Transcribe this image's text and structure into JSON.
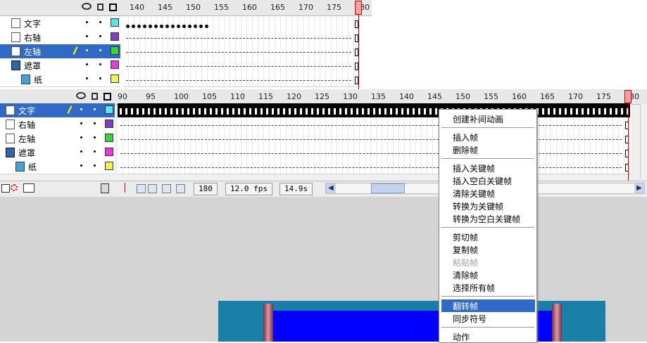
{
  "top_panel": {
    "ruler_ticks": [
      "140",
      "145",
      "150",
      "155",
      "160",
      "165",
      "170",
      "175",
      "180"
    ],
    "layers": [
      {
        "name": "文字",
        "icon": "layer-icon",
        "color": "#5ee3ee"
      },
      {
        "name": "右轴",
        "icon": "layer-icon",
        "color": "#7d3ec0"
      },
      {
        "name": "左轴",
        "icon": "layer-icon",
        "color": "#3ad13a",
        "selected": true
      },
      {
        "name": "遮罩",
        "icon": "mask-layer-icon",
        "color": "#e23ed8"
      },
      {
        "name": "纸",
        "icon": "masked-layer-icon",
        "color": "#f3ef5a"
      }
    ]
  },
  "bottom_panel": {
    "ruler_ticks": [
      "90",
      "95",
      "100",
      "105",
      "110",
      "115",
      "120",
      "125",
      "130",
      "135",
      "140",
      "145",
      "150",
      "155",
      "160",
      "165",
      "170",
      "175",
      "180"
    ],
    "layers": [
      {
        "name": "文字",
        "icon": "layer-icon",
        "color": "#5ee3ee",
        "selected": true
      },
      {
        "name": "右轴",
        "icon": "layer-icon",
        "color": "#7d3ec0"
      },
      {
        "name": "左轴",
        "icon": "layer-icon",
        "color": "#3ad13a"
      },
      {
        "name": "遮罩",
        "icon": "mask-layer-icon",
        "color": "#e23ed8"
      },
      {
        "name": "纸",
        "icon": "masked-layer-icon",
        "color": "#f3ef5a"
      }
    ],
    "status": {
      "frame": "180",
      "fps": "12.0 fps",
      "time": "14.9s"
    }
  },
  "context_menu": {
    "items": [
      {
        "label": "创建补间动画"
      },
      {
        "label": "插入帧"
      },
      {
        "label": "删除帧"
      },
      {
        "label": "插入关键帧"
      },
      {
        "label": "插入空白关键帧"
      },
      {
        "label": "清除关键帧"
      },
      {
        "label": "转换为关键帧"
      },
      {
        "label": "转换为空白关键帧"
      },
      {
        "label": "剪切帧"
      },
      {
        "label": "复制帧"
      },
      {
        "label": "粘贴帧",
        "disabled": true
      },
      {
        "label": "清除帧"
      },
      {
        "label": "选择所有帧"
      },
      {
        "label": "翻转帧",
        "highlighted": true
      },
      {
        "label": "同步符号"
      },
      {
        "label": "动作"
      }
    ]
  },
  "colors": {
    "selection": "#316ac5",
    "stage_bg": "#d4d4d4",
    "canvas_teal": "#1a7fa6",
    "canvas_blue": "#0000ff",
    "playhead": "#cc0000"
  }
}
